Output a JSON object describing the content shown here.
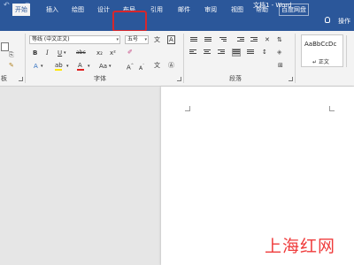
{
  "window": {
    "title": "文档1 - Word"
  },
  "qat": {
    "undo_icon": "undo-icon",
    "redo_icon": "redo-icon",
    "undo_glyph": "↶",
    "redo_glyph": "○"
  },
  "tabs": [
    {
      "label": "开始",
      "active": true
    },
    {
      "label": "插入"
    },
    {
      "label": "绘图"
    },
    {
      "label": "设计"
    },
    {
      "label": "布局",
      "highlighted": true
    },
    {
      "label": "引用"
    },
    {
      "label": "邮件"
    },
    {
      "label": "审阅"
    },
    {
      "label": "视图"
    },
    {
      "label": "帮助"
    },
    {
      "label": "百度网盘"
    },
    {
      "label": "操作"
    }
  ],
  "font": {
    "name": "等线 (中文正文)",
    "size": "五号",
    "group_label": "字体",
    "bold": "B",
    "italic": "I",
    "underline": "U",
    "strike": "abc",
    "subscript": "x₂",
    "superscript": "x²",
    "change_case": "Aa",
    "grow": "A",
    "shrink": "A"
  },
  "paragraph": {
    "group_label": "段落"
  },
  "clipboard": {
    "group_label": "板"
  },
  "styles": {
    "sample": "AaBbCcDc",
    "normal_label": "↵ 正文"
  },
  "colors": {
    "ribbon_blue": "#2b579a",
    "highlight_yellow": "#ffe600",
    "font_red": "#e02020",
    "annotation_red": "#d6272d",
    "watermark_red": "#ef3b3b"
  },
  "watermark": "上海红网"
}
